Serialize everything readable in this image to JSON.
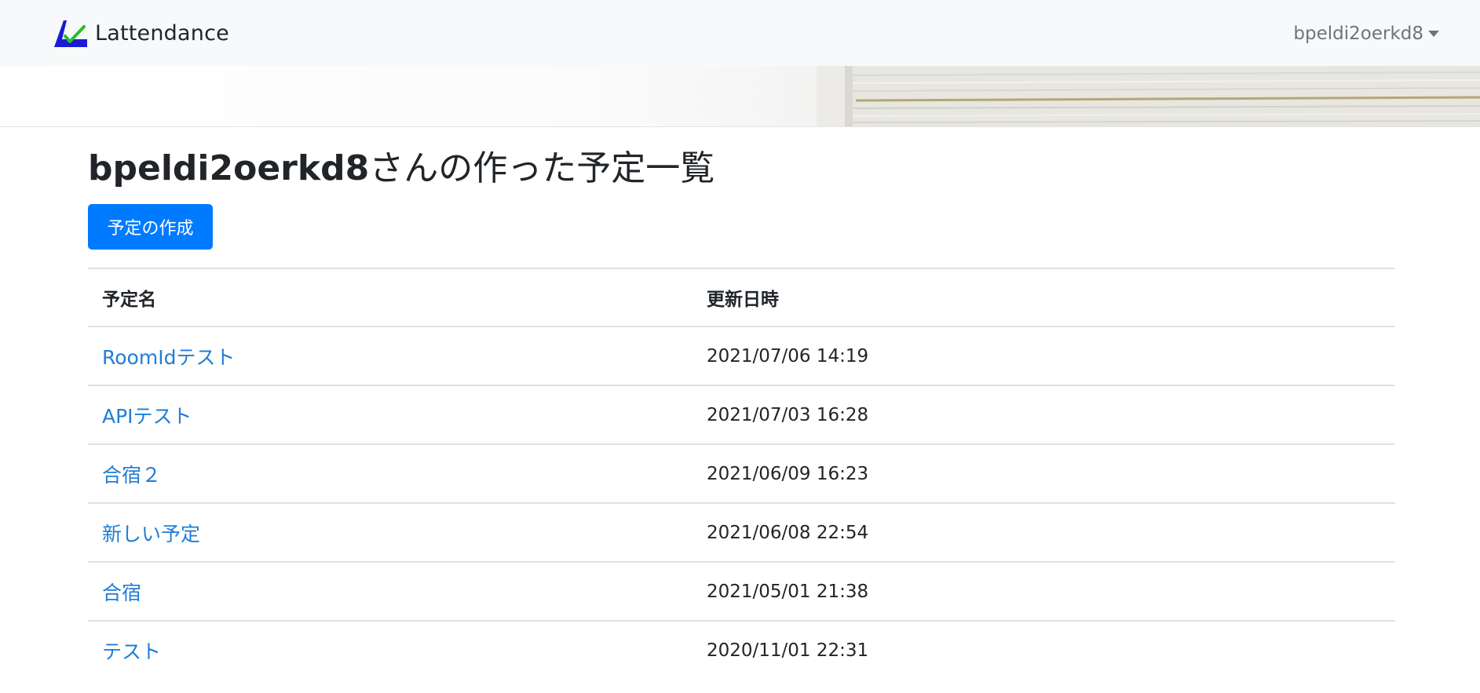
{
  "navbar": {
    "brand": "Lattendance",
    "user": "bpeldi2oerkd8"
  },
  "page": {
    "title_user": "bpeldi2oerkd8",
    "title_suffix": "さんの作った予定一覧",
    "create_button": "予定の作成"
  },
  "table": {
    "headers": [
      "予定名",
      "更新日時"
    ],
    "rows": [
      {
        "name": "RoomIdテスト",
        "updated": "2021/07/06 14:19"
      },
      {
        "name": "APIテスト",
        "updated": "2021/07/03 16:28"
      },
      {
        "name": "合宿２",
        "updated": "2021/06/09 16:23"
      },
      {
        "name": "新しい予定",
        "updated": "2021/06/08 22:54"
      },
      {
        "name": "合宿",
        "updated": "2021/05/01 21:38"
      },
      {
        "name": "テスト",
        "updated": "2020/11/01 22:31"
      }
    ]
  },
  "colors": {
    "primary": "#007bff",
    "link": "#1f7dd6",
    "navbar_bg": "#f8f9fa"
  }
}
